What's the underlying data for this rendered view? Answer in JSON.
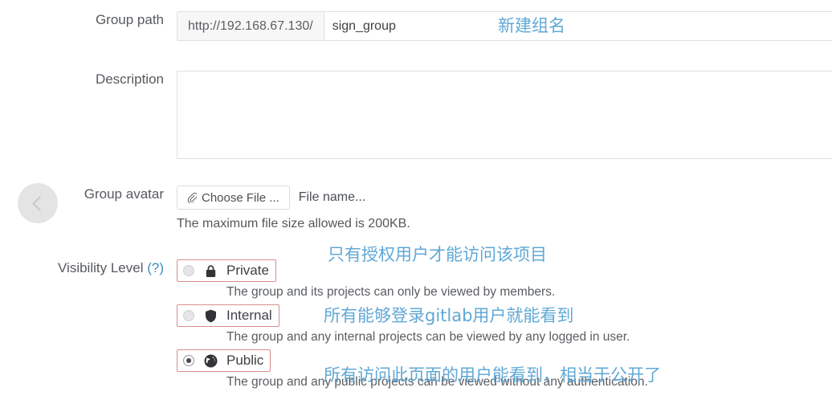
{
  "sidebar": {
    "toggle_icon": "chevron-left-icon"
  },
  "form": {
    "group_path": {
      "label": "Group path",
      "url_prefix": "http://192.168.67.130/",
      "value": "sign_group",
      "placeholder": "",
      "annotation": "新建组名"
    },
    "description": {
      "label": "Description",
      "value": "",
      "placeholder": ""
    },
    "group_avatar": {
      "label": "Group avatar",
      "choose_file_label": "Choose File ...",
      "choose_file_icon": "paperclip-icon",
      "file_name_text": "File name...",
      "help_text": "The maximum file size allowed is 200KB."
    },
    "visibility": {
      "label": "Visibility Level",
      "help_marker": "(?)",
      "options": [
        {
          "name": "Private",
          "icon": "lock-icon",
          "selected": false,
          "help": "The group and its projects can only be viewed by members.",
          "annotation": "只有授权用户才能访问该项目"
        },
        {
          "name": "Internal",
          "icon": "shield-icon",
          "selected": false,
          "help": "The group and any internal projects can be viewed by any logged in user.",
          "annotation": "所有能够登录gitlab用户就能看到"
        },
        {
          "name": "Public",
          "icon": "globe-icon",
          "selected": true,
          "help": "The group and any public projects can be viewed without any authentication.",
          "annotation": "所有访问此页面的用户能看到，相当于公开了"
        }
      ]
    }
  },
  "colors": {
    "annotation_blue": "#60a8d6",
    "highlight_red": "#d98d8d",
    "label_gray": "#56595e",
    "addon_bg": "#f7f7f7"
  }
}
